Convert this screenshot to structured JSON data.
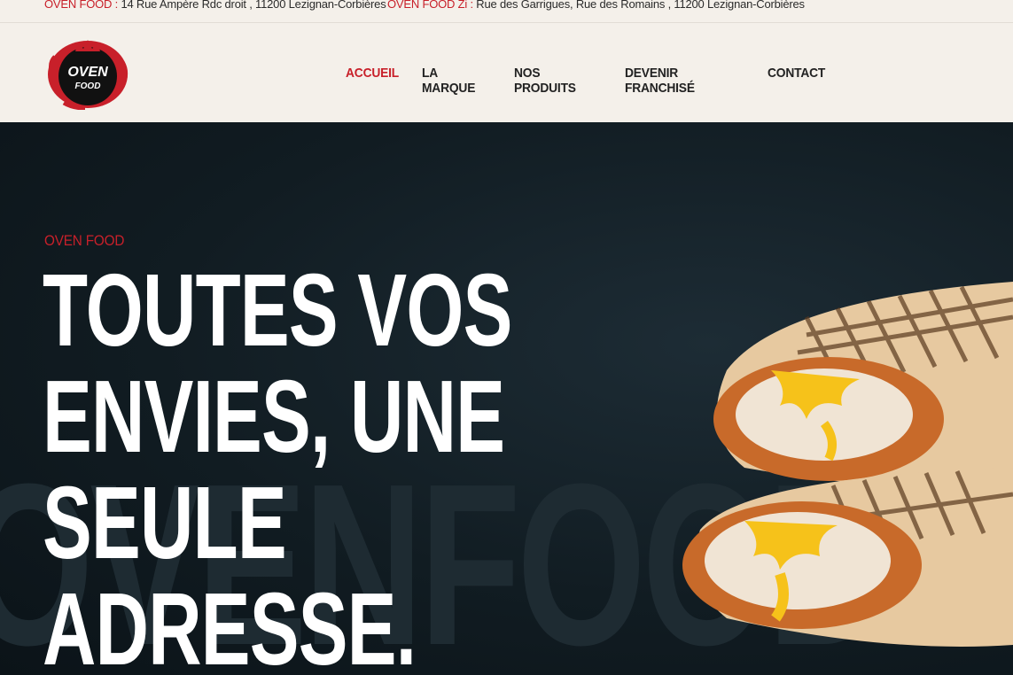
{
  "topbar": {
    "address1_brand": "OVEN FOOD : ",
    "address1_text": "14 Rue Ampère Rdc droit , 11200 Lezignan-Corbières",
    "address2_brand": "OVEN FOOD Zi : ",
    "address2_text": "Rue des Garrigues, Rue des Romains , 11200 Lezignan-Corbières"
  },
  "logo": {
    "line1": "OVEN",
    "line2": "FOOD"
  },
  "nav": {
    "items": [
      {
        "label": "ACCUEIL",
        "active": true
      },
      {
        "label": "LA MARQUE",
        "active": false
      },
      {
        "label": "NOS PRODUITS",
        "active": false
      },
      {
        "label": "DEVENIR FRANCHISÉ",
        "active": false
      },
      {
        "label": "CONTACT",
        "active": false
      }
    ]
  },
  "hero": {
    "eyebrow": "OVEN FOOD",
    "headline": "TOUTES VOS ENVIES, UNE SEULE ADRESSE.",
    "background_word": "OVENFOOD"
  },
  "colors": {
    "accent": "#c8202a",
    "nav_bg": "#f4f0ea",
    "hero_bg": "#111c22"
  }
}
